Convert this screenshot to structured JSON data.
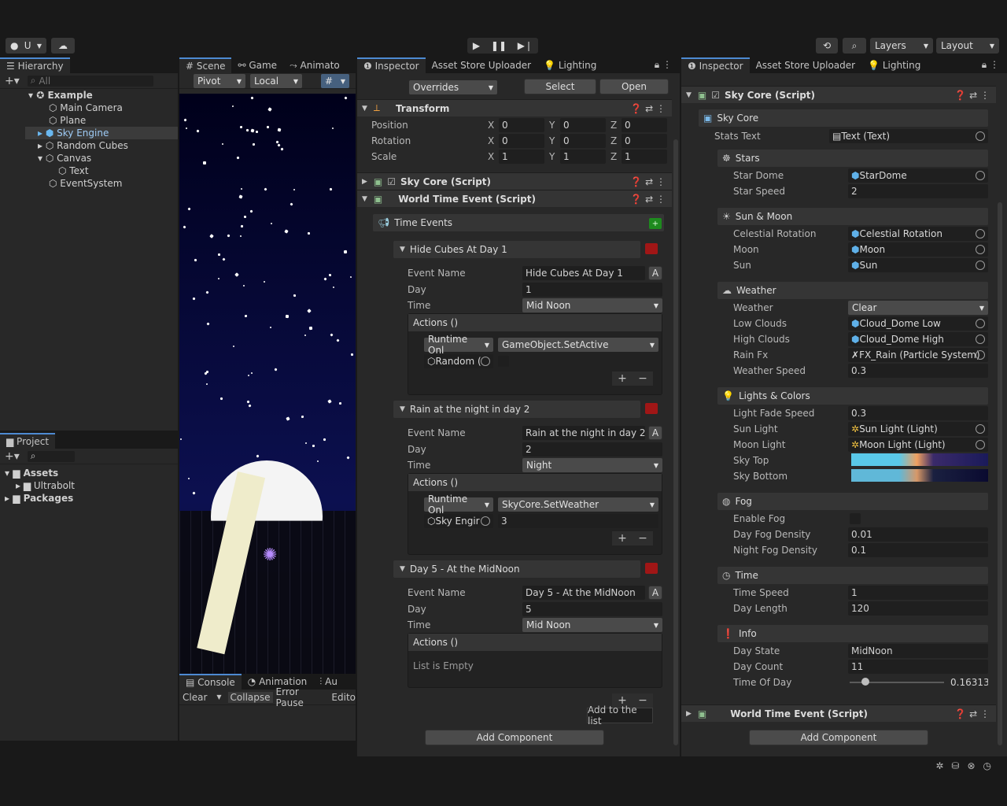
{
  "toolbar": {
    "account": "U",
    "layers": "Layers",
    "layout": "Layout"
  },
  "hierarchy": {
    "tab": "Hierarchy",
    "search_placeholder": "All",
    "items": [
      "Example",
      "Main Camera",
      "Plane",
      "Sky Engine",
      "Random Cubes",
      "Canvas",
      "Text",
      "EventSystem"
    ]
  },
  "project": {
    "tab": "Project",
    "items": [
      "Assets",
      "Ultrabolt",
      "Packages"
    ]
  },
  "scene": {
    "tabs": [
      "Scene",
      "Game",
      "Animato"
    ],
    "pivot": "Pivot",
    "local": "Local"
  },
  "console": {
    "tabs": [
      "Console",
      "Animation",
      "Au"
    ],
    "buttons": [
      "Clear",
      "Collapse",
      "Error Pause",
      "Edito"
    ]
  },
  "inspector1": {
    "tabs": [
      "Inspector",
      "Asset Store Uploader",
      "Lighting"
    ],
    "overrides": "Overrides",
    "select": "Select",
    "open": "Open",
    "transform": {
      "title": "Transform",
      "rows": [
        {
          "label": "Position",
          "x": "0",
          "y": "0",
          "z": "0"
        },
        {
          "label": "Rotation",
          "x": "0",
          "y": "0",
          "z": "0"
        },
        {
          "label": "Scale",
          "x": "1",
          "y": "1",
          "z": "1"
        }
      ]
    },
    "sky_core": "Sky Core (Script)",
    "world_time": "World Time Event (Script)",
    "time_events": "Time Events",
    "events": [
      {
        "title": "Hide Cubes At Day 1",
        "event_name": "Hide Cubes At Day 1",
        "day": "1",
        "time": "Mid Noon",
        "mode": "Runtime Onl",
        "func": "GameObject.SetActive",
        "obj": "Random (",
        "arg": ""
      },
      {
        "title": "Rain at the night in day 2",
        "event_name": "Rain at the night in day 2",
        "day": "2",
        "time": "Night",
        "mode": "Runtime Onl",
        "func": "SkyCore.SetWeather",
        "obj": "Sky Engir",
        "arg": "3"
      },
      {
        "title": "Day 5 - At the MidNoon",
        "event_name": "Day 5 - At the MidNoon",
        "day": "5",
        "time": "Mid Noon",
        "empty": "List is Empty"
      }
    ],
    "labels": {
      "event_name": "Event Name",
      "day": "Day",
      "time": "Time",
      "actions": "Actions ()"
    },
    "tooltip": "Add to the list",
    "add_component": "Add Component"
  },
  "inspector2": {
    "tabs": [
      "Inspector",
      "Asset Store Uploader",
      "Lighting"
    ],
    "title": "Sky Core (Script)",
    "sky_core": "Sky Core",
    "stats_text_label": "Stats Text",
    "stats_text": "Text (Text)",
    "stars": {
      "title": "Stars",
      "rows": [
        [
          "Star Dome",
          "StarDome"
        ],
        [
          "Star Speed",
          "2"
        ]
      ]
    },
    "sunmoon": {
      "title": "Sun & Moon",
      "rows": [
        [
          "Celestial Rotation",
          "Celestial Rotation"
        ],
        [
          "Moon",
          "Moon"
        ],
        [
          "Sun",
          "Sun"
        ]
      ]
    },
    "weather": {
      "title": "Weather",
      "rows": [
        [
          "Weather",
          "Clear"
        ],
        [
          "Low Clouds",
          "Cloud_Dome Low"
        ],
        [
          "High Clouds",
          "Cloud_Dome High"
        ],
        [
          "Rain Fx",
          "FX_Rain (Particle System)"
        ],
        [
          "Weather Speed",
          "0.3"
        ]
      ]
    },
    "lights": {
      "title": "Lights & Colors",
      "rows": [
        [
          "Light Fade Speed",
          "0.3"
        ],
        [
          "Sun Light",
          "Sun Light (Light)"
        ],
        [
          "Moon Light",
          "Moon Light (Light)"
        ],
        [
          "Sky Top",
          ""
        ],
        [
          "Sky Bottom",
          ""
        ]
      ]
    },
    "fog": {
      "title": "Fog",
      "rows": [
        [
          "Enable Fog",
          ""
        ],
        [
          "Day Fog Density",
          "0.01"
        ],
        [
          "Night Fog Density",
          "0.1"
        ]
      ]
    },
    "time": {
      "title": "Time",
      "rows": [
        [
          "Time Speed",
          "1"
        ],
        [
          "Day Length",
          "120"
        ]
      ]
    },
    "info": {
      "title": "Info",
      "rows": [
        [
          "Day State",
          "MidNoon"
        ],
        [
          "Day Count",
          "11"
        ],
        [
          "Time Of Day",
          "0.16313"
        ]
      ]
    },
    "time_of_day_fraction": 0.16313,
    "world_time": "World Time Event (Script)",
    "add_component": "Add Component"
  }
}
